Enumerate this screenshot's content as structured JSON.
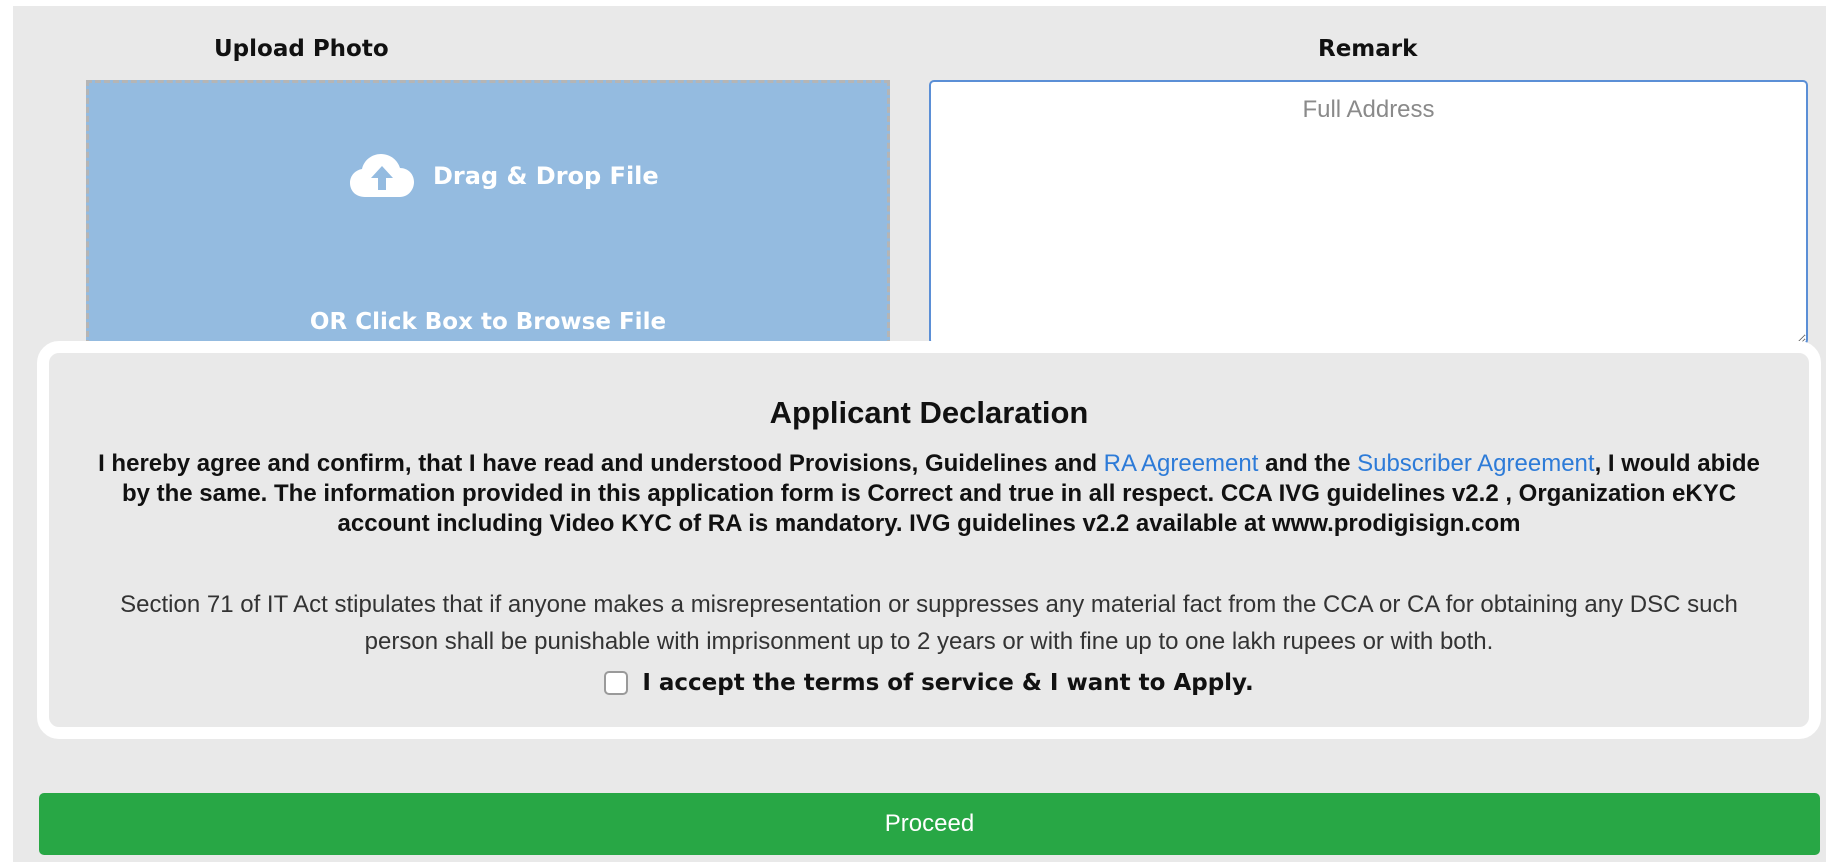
{
  "upload": {
    "label": "Upload Photo",
    "drag_text": "Drag & Drop File",
    "browse_text": "OR Click Box to Browse File",
    "icon": "cloud-upload-icon"
  },
  "remark": {
    "label": "Remark",
    "placeholder": "Full Address",
    "value": ""
  },
  "declaration": {
    "title": "Applicant Declaration",
    "text_part1": "I hereby agree and confirm, that I have read and understood Provisions, Guidelines and ",
    "link_ra_agreement": "RA Agreement",
    "text_part2": " and the ",
    "link_subscriber_agreement": "Subscriber Agreement",
    "text_part3": ", I would abide by the same. The information provided in this application form is Correct and true in all respect. CCA IVG guidelines v2.2 , Organization eKYC account including Video KYC of RA is mandatory. IVG guidelines v2.2 available at www.prodigisign.com",
    "section_text": "Section 71 of IT Act stipulates that if anyone makes a misrepresentation or suppresses any material fact from the CCA or CA for obtaining any DSC such person shall be punishable with imprisonment up to 2 years or with fine up to one lakh rupees or with both.",
    "accept_label": "I accept the terms of service & I want to Apply.",
    "accepted": false
  },
  "proceed_label": "Proceed",
  "colors": {
    "page_bg": "#e9e9e9",
    "dropzone_bg": "#94bbe0",
    "link": "#2d7bd8",
    "proceed_bg": "#28a745",
    "remark_border": "#5b8fd6"
  }
}
